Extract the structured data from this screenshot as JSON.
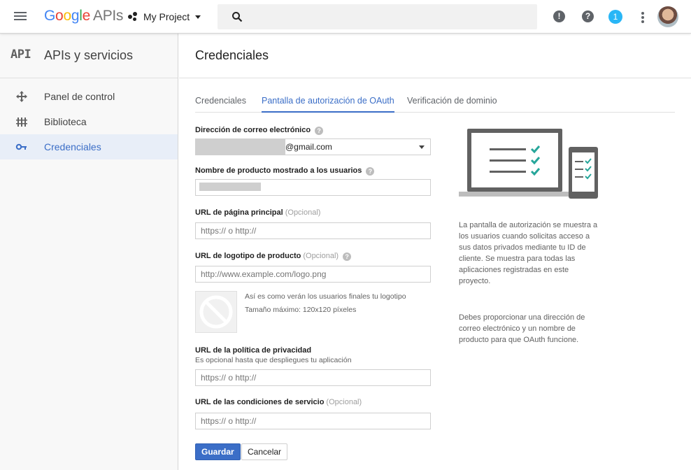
{
  "topbar": {
    "logo": {
      "g1": "G",
      "g2": "o",
      "g3": "o",
      "g4": "g",
      "g5": "l",
      "g6": "e",
      "suffix": "APIs"
    },
    "project_label": "My Project",
    "search_placeholder": "",
    "notification_count": "1",
    "feedback_icon": "!",
    "help_icon": "?"
  },
  "sidebar": {
    "api_mark": "API",
    "title": "APIs y servicios",
    "items": [
      {
        "label": "Panel de control",
        "icon": "dashboard-icon"
      },
      {
        "label": "Biblioteca",
        "icon": "library-icon"
      },
      {
        "label": "Credenciales",
        "icon": "key-icon",
        "active": true
      }
    ]
  },
  "main": {
    "title": "Credenciales",
    "tabs": [
      {
        "label": "Credenciales"
      },
      {
        "label": "Pantalla de autorización de OAuth",
        "active": true
      },
      {
        "label": "Verificación de dominio"
      }
    ]
  },
  "form": {
    "email": {
      "label": "Dirección de correo electrónico",
      "value": "@gmail.com"
    },
    "product_name": {
      "label": "Nombre de producto mostrado a los usuarios",
      "value": ""
    },
    "homepage": {
      "label": "URL de página principal",
      "optional": "(Opcional)",
      "placeholder": "https:// o http://"
    },
    "logo_url": {
      "label": "URL de logotipo de producto",
      "optional": "(Opcional)",
      "placeholder": "http://www.example.com/logo.png"
    },
    "logo_note_1": "Así es como verán los usuarios finales tu logotipo",
    "logo_note_2": "Tamaño máximo: 120x120 píxeles",
    "privacy": {
      "label": "URL de la política de privacidad",
      "sub": "Es opcional hasta que despliegues tu aplicación",
      "placeholder": "https:// o http://"
    },
    "terms": {
      "label": "URL de las condiciones de servicio",
      "optional": "(Opcional)",
      "placeholder": "https:// o http://"
    },
    "save": "Guardar",
    "cancel": "Cancelar"
  },
  "info": {
    "p1": "La pantalla de autorización se muestra a los usuarios cuando solicitas acceso a sus datos privados mediante tu ID de cliente. Se muestra para todas las aplicaciones registradas en este proyecto.",
    "p2": "Debes proporcionar una dirección de correo electrónico y un nombre de producto para que OAuth funcione."
  },
  "colors": {
    "accent": "#3b6ec7",
    "sidebar_active_bg": "#e8eef8",
    "check_green": "#26a69a"
  }
}
